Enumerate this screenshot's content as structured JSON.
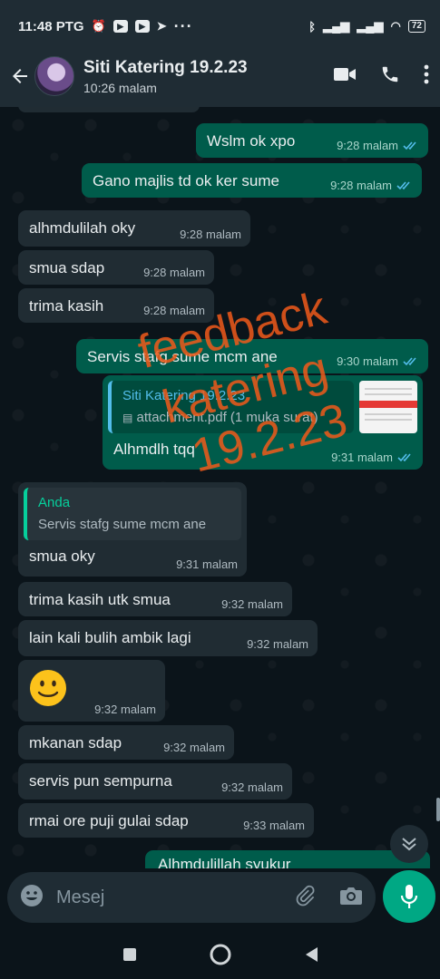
{
  "status_bar": {
    "time": "11:48 PTG",
    "battery": "72"
  },
  "header": {
    "title": "Siti Katering 19.2.23",
    "subtitle": "10:26 malam"
  },
  "messages": [
    {
      "dir": "out",
      "text": "Wslm ok xpo",
      "time": "9:28 malam"
    },
    {
      "dir": "out",
      "text": "Gano majlis td ok ker sume",
      "time": "9:28 malam"
    },
    {
      "dir": "in",
      "text": "alhmdulilah oky",
      "time": "9:28 malam"
    },
    {
      "dir": "in",
      "text": "smua sdap",
      "time": "9:28 malam"
    },
    {
      "dir": "in",
      "text": "trima kasih",
      "time": "9:28 malam"
    },
    {
      "dir": "out",
      "text": "Servis stafg sume mcm ane",
      "time": "9:30 malam"
    },
    {
      "dir": "out",
      "quote_name": "Siti Katering 19.2.23",
      "quote_text": "attachment.pdf (1 muka surat)",
      "text": "Alhmdlh tqq",
      "time": "9:31 malam"
    },
    {
      "dir": "in",
      "quote_name": "Anda",
      "quote_text": "Servis stafg sume mcm ane",
      "text": "smua oky",
      "time": "9:31 malam"
    },
    {
      "dir": "in",
      "text": "trima kasih utk smua",
      "time": "9:32 malam"
    },
    {
      "dir": "in",
      "text": "lain kali bulih ambik lagi",
      "time": "9:32 malam"
    },
    {
      "dir": "in",
      "emoji": "slightly-smiling-face",
      "time": "9:32 malam"
    },
    {
      "dir": "in",
      "text": "mkanan sdap",
      "time": "9:32 malam"
    },
    {
      "dir": "in",
      "text": "servis pun sempurna",
      "time": "9:32 malam"
    },
    {
      "dir": "in",
      "text": "rmai ore puji gulai sdap",
      "time": "9:33 malam"
    },
    {
      "dir": "out",
      "text": "Alhmdulillah syukur",
      "time": ""
    }
  ],
  "watermark": {
    "lines": [
      "feedback",
      "katering",
      "19.2.23"
    ],
    "color": "#f05a1a"
  },
  "composer": {
    "placeholder": "Mesej"
  },
  "colors": {
    "incoming": "#202c33",
    "outgoing": "#005c4b",
    "accent": "#00a884",
    "read_tick": "#53bdeb"
  },
  "icons": [
    "back-arrow-icon",
    "video-call-icon",
    "phone-icon",
    "more-vert-icon",
    "emoji-icon",
    "attach-icon",
    "camera-icon",
    "mic-icon",
    "chevron-double-down-icon",
    "document-icon"
  ]
}
